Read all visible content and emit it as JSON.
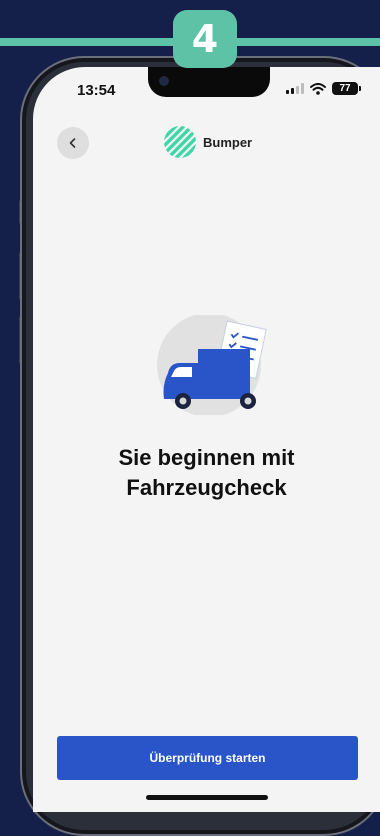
{
  "step": {
    "number": "4",
    "color": "#5ec3a6"
  },
  "status_bar": {
    "time": "13:54",
    "battery": "77"
  },
  "header": {
    "back_icon": "chevron-left-icon",
    "logo_icon": "striped-circle-logo",
    "brand": "Bumper"
  },
  "main": {
    "illustration": "delivery-van-with-checklist",
    "title_line1": "Sie beginnen mit",
    "title_line2": "Fahrzeugcheck"
  },
  "footer": {
    "cta_label": "Überprüfung starten"
  },
  "colors": {
    "background": "#15204a",
    "screen": "#f4f4f4",
    "primary": "#2a55c9",
    "accent": "#5ec3a6"
  }
}
